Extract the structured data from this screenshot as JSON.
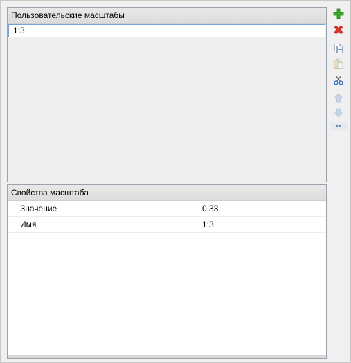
{
  "scales_panel": {
    "title": "Пользовательские масштабы",
    "items": [
      "1:3"
    ]
  },
  "properties_panel": {
    "title": "Свойства масштаба",
    "rows": [
      {
        "name": "Значение",
        "value": "0.33"
      },
      {
        "name": "Имя",
        "value": "1:3"
      }
    ]
  },
  "toolbar": {
    "buttons": [
      {
        "icon": "add-icon",
        "enabled": true,
        "color": "#3aa72a"
      },
      {
        "icon": "delete-icon",
        "enabled": true,
        "color": "#d9302a"
      },
      {
        "icon": "copy-icon",
        "enabled": true
      },
      {
        "icon": "paste-icon",
        "enabled": false
      },
      {
        "icon": "cut-icon",
        "enabled": true
      },
      {
        "icon": "move-up-icon",
        "enabled": false
      },
      {
        "icon": "move-down-icon",
        "enabled": false
      },
      {
        "icon": "overflow-chevron-icon",
        "enabled": true
      }
    ]
  }
}
